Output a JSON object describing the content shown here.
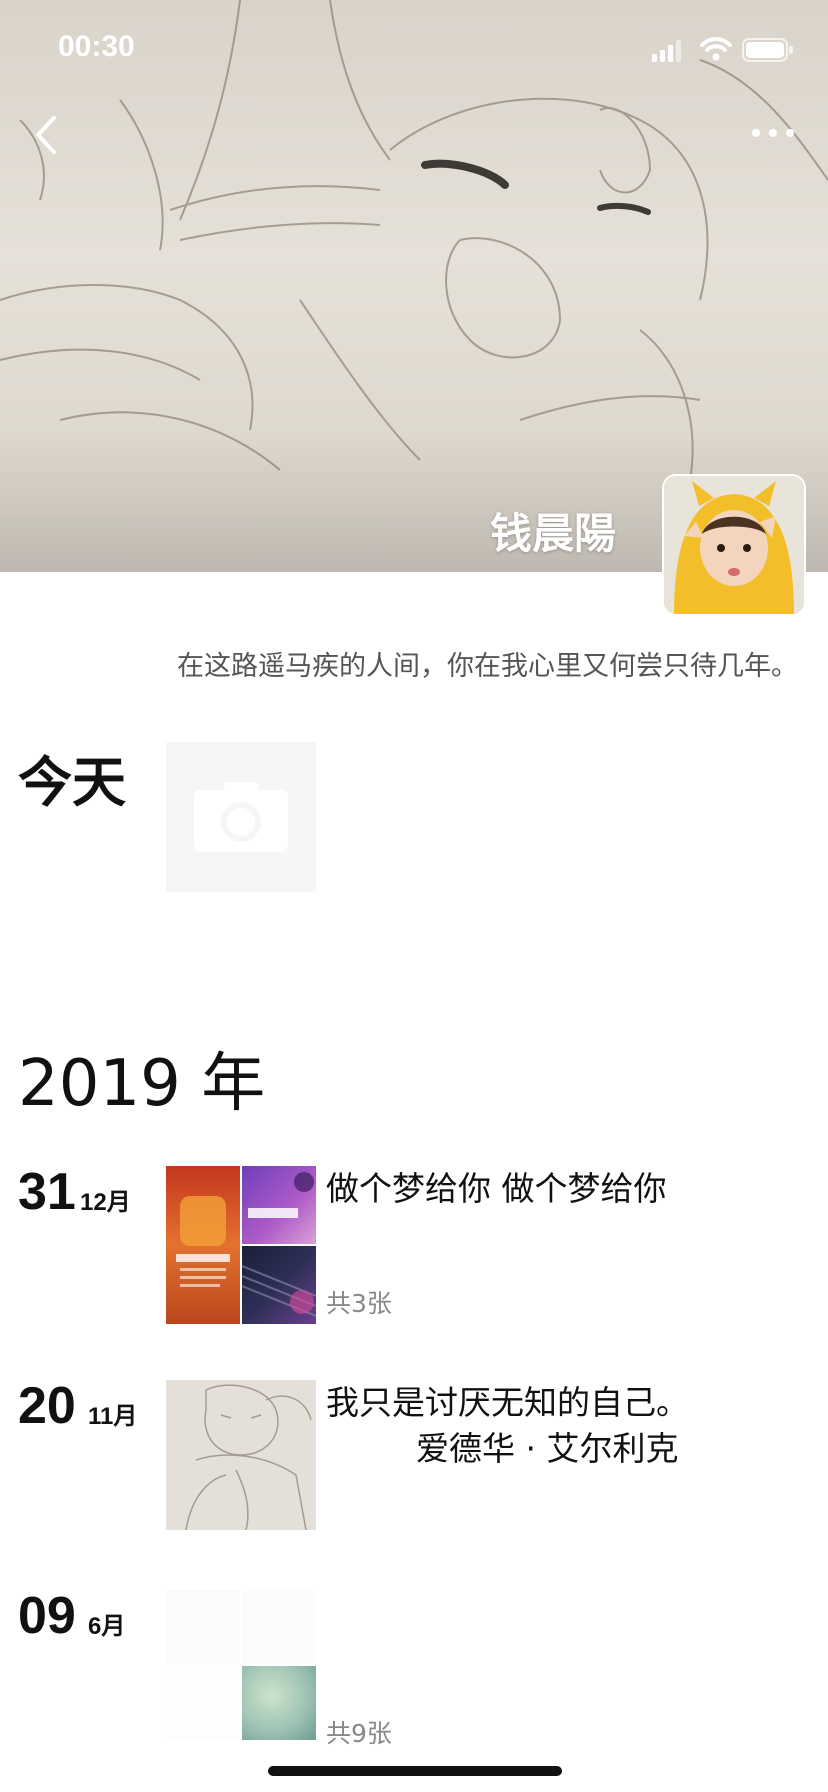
{
  "status_bar": {
    "time": "00:30"
  },
  "profile": {
    "name": "钱晨陽",
    "signature": "在这路遥马疾的人间，你在我心里又何尝只待几年。"
  },
  "today": {
    "label": "今天"
  },
  "year": {
    "label": "2019 年"
  },
  "posts": [
    {
      "day": "31",
      "month": "12月",
      "text_lines": [
        "做个梦给你 做个梦给你"
      ],
      "count": "共3张"
    },
    {
      "day": "20",
      "month": "11月",
      "text_lines": [
        "我只是讨厌无知的自己。",
        "爱德华 · 艾尔利克"
      ],
      "count": ""
    },
    {
      "day": "09",
      "month": "6月",
      "text_lines": [],
      "count": "共9张"
    }
  ],
  "icons": {
    "back": "chevron-left-icon",
    "more": "more-dots-icon",
    "camera": "camera-icon",
    "signal": "signal-icon",
    "wifi": "wifi-icon",
    "battery": "battery-icon"
  }
}
